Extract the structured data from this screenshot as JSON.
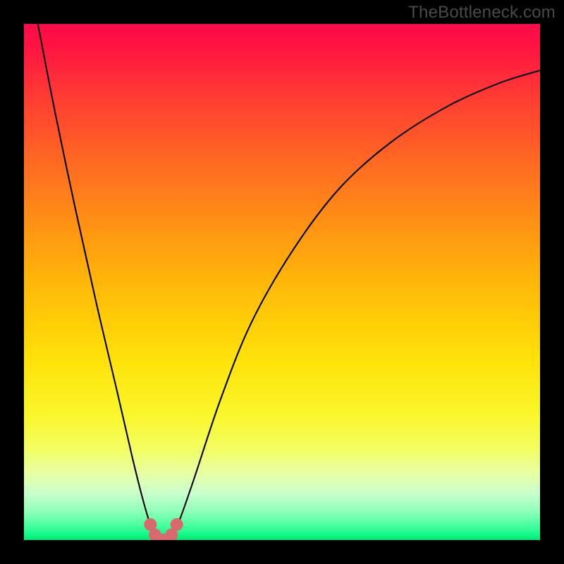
{
  "watermark": "TheBottleneck.com",
  "chart_data": {
    "type": "line",
    "title": "",
    "xlabel": "",
    "ylabel": "",
    "xlim": [
      0,
      1
    ],
    "ylim": [
      0,
      1
    ],
    "gradient_stops": [
      {
        "pos": 0.0,
        "color": "#ff0b48"
      },
      {
        "pos": 0.27,
        "color": "#ff6a22"
      },
      {
        "pos": 0.52,
        "color": "#ffbd08"
      },
      {
        "pos": 0.76,
        "color": "#faf72c"
      },
      {
        "pos": 0.91,
        "color": "#c8ffcd"
      },
      {
        "pos": 1.0,
        "color": "#00e873"
      }
    ],
    "series": [
      {
        "name": "bottleneck-curve",
        "color": "#000000",
        "points": [
          {
            "x": 0.027,
            "y": 1.0
          },
          {
            "x": 0.06,
            "y": 0.83
          },
          {
            "x": 0.1,
            "y": 0.64
          },
          {
            "x": 0.14,
            "y": 0.46
          },
          {
            "x": 0.18,
            "y": 0.29
          },
          {
            "x": 0.21,
            "y": 0.16
          },
          {
            "x": 0.23,
            "y": 0.08
          },
          {
            "x": 0.245,
            "y": 0.03
          },
          {
            "x": 0.258,
            "y": 0.005
          },
          {
            "x": 0.27,
            "y": 0.0
          },
          {
            "x": 0.283,
            "y": 0.005
          },
          {
            "x": 0.3,
            "y": 0.035
          },
          {
            "x": 0.33,
            "y": 0.12
          },
          {
            "x": 0.38,
            "y": 0.27
          },
          {
            "x": 0.44,
            "y": 0.42
          },
          {
            "x": 0.52,
            "y": 0.56
          },
          {
            "x": 0.61,
            "y": 0.68
          },
          {
            "x": 0.71,
            "y": 0.77
          },
          {
            "x": 0.82,
            "y": 0.84
          },
          {
            "x": 0.92,
            "y": 0.885
          },
          {
            "x": 1.0,
            "y": 0.91
          }
        ]
      },
      {
        "name": "highlight-dots",
        "color": "#d86a6f",
        "points": [
          {
            "x": 0.245,
            "y": 0.03
          },
          {
            "x": 0.254,
            "y": 0.01
          },
          {
            "x": 0.27,
            "y": 0.0
          },
          {
            "x": 0.286,
            "y": 0.01
          },
          {
            "x": 0.296,
            "y": 0.03
          }
        ]
      }
    ]
  }
}
